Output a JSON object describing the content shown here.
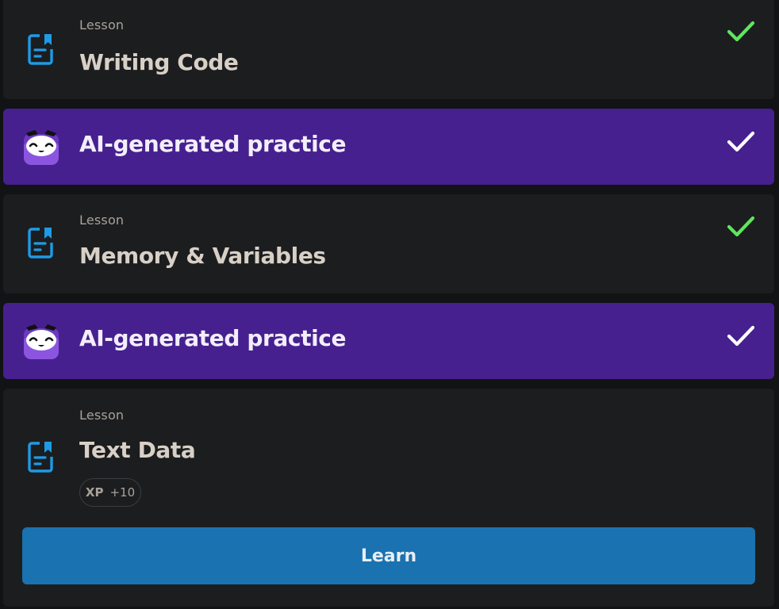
{
  "items": [
    {
      "type": "lesson",
      "kicker": "Lesson",
      "title": "Writing Code",
      "completed": true,
      "check_color": "#5ee65e",
      "icon": "document-bookmark-icon"
    },
    {
      "type": "ai_practice",
      "title": "AI-generated practice",
      "completed": true,
      "check_color": "#ffffff",
      "icon": "ai-mascot-icon"
    },
    {
      "type": "lesson",
      "kicker": "Lesson",
      "title": "Memory & Variables",
      "completed": true,
      "check_color": "#5ee65e",
      "icon": "document-bookmark-icon"
    },
    {
      "type": "ai_practice",
      "title": "AI-generated practice",
      "completed": true,
      "check_color": "#ffffff",
      "icon": "ai-mascot-icon"
    },
    {
      "type": "lesson",
      "kicker": "Lesson",
      "title": "Text Data",
      "completed": false,
      "icon": "document-bookmark-icon",
      "xp": {
        "label": "XP",
        "value": "+10"
      },
      "action": {
        "label": "Learn"
      }
    }
  ],
  "colors": {
    "background": "#121314",
    "lesson_card": "#1c1d1f",
    "ai_card": "#46208f",
    "accent_blue": "#1a72b0",
    "icon_blue": "#1e9be6",
    "check_green": "#5ee65e"
  }
}
